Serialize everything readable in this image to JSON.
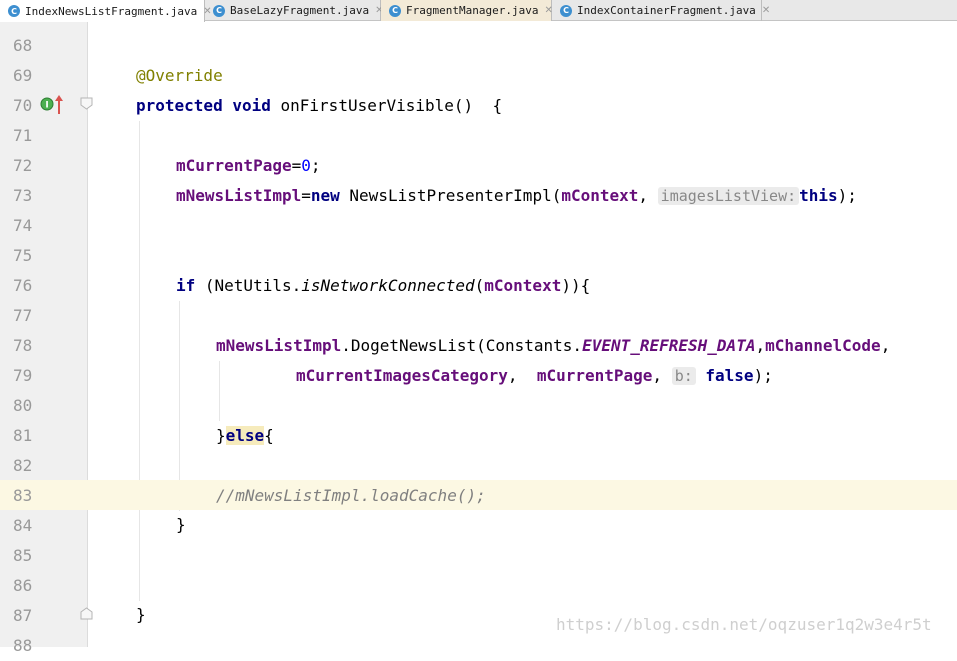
{
  "tabs": [
    {
      "label": "IndexNewsListFragment.java",
      "icon": "class-icon",
      "active": true
    },
    {
      "label": "BaseLazyFragment.java",
      "icon": "class-icon",
      "active": false
    },
    {
      "label": "FragmentManager.java",
      "icon": "class-locked-icon",
      "active": false
    },
    {
      "label": "IndexContainerFragment.java",
      "icon": "class-icon",
      "active": false
    }
  ],
  "gutter": {
    "line_numbers": [
      "68",
      "69",
      "70",
      "71",
      "72",
      "73",
      "74",
      "75",
      "76",
      "77",
      "78",
      "79",
      "80",
      "81",
      "82",
      "83",
      "84",
      "85",
      "86",
      "87",
      "88"
    ],
    "current_line": "83",
    "override_marker_icon": "implements-up-arrow-icon",
    "intention_icon": "lightbulb-icon"
  },
  "code": {
    "l69_annotation": "@Override",
    "l70_kw_protected": "protected",
    "l70_kw_void": "void",
    "l70_method": "onFirstUserVisible",
    "l70_rest": "()  {",
    "l72_field": "mCurrentPage",
    "l72_eq": "=",
    "l72_num": "0",
    "l72_semi": ";",
    "l73_field": "mNewsListImpl",
    "l73_eq": "=",
    "l73_kw_new": "new",
    "l73_class": " NewsListPresenterImpl(",
    "l73_arg_field": "mContext",
    "l73_comma": ", ",
    "l73_hint": "imagesListView:",
    "l73_kw_this": "this",
    "l73_end": ");",
    "l76_kw_if": "if",
    "l76_open": " (NetUtils.",
    "l76_method": "isNetworkConnected",
    "l76_paren": "(",
    "l76_field": "mContext",
    "l76_end": ")){",
    "l78_field": "mNewsListImpl",
    "l78_call": ".DogetNewsList(Constants.",
    "l78_const": "EVENT_REFRESH_DATA",
    "l78_comma": ",",
    "l78_field2": "mChannelCode",
    "l78_comma2": ",",
    "l79_field": "mCurrentImagesCategory",
    "l79_comma": ",  ",
    "l79_field2": "mCurrentPage",
    "l79_comma2": ", ",
    "l79_hint": "b:",
    "l79_kw_false": "false",
    "l79_end": ");",
    "l81_brace": "}",
    "l81_kw_else": "else",
    "l81_open": "{",
    "l83_comment": "//mNewsListImpl.loadCache();",
    "l84_brace": "}",
    "l87_brace": "}"
  },
  "watermark": "https://blog.csdn.net/oqzuser1q2w3e4r5t",
  "colors": {
    "keyword": "#000080",
    "field": "#660e7a",
    "number": "#0000ff",
    "annotation": "#808000",
    "comment": "#808080",
    "caret_row": "#fcf8e3",
    "gutter_bg": "#f0f0f0",
    "class_icon": "#3d8fd0"
  }
}
